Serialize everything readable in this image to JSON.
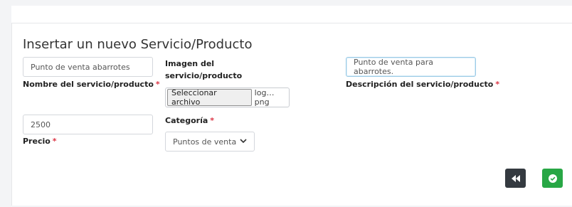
{
  "form": {
    "title": "Insertar un nuevo Servicio/Producto",
    "name_field": {
      "value": "Punto de venta abarrotes",
      "label": "Nombre del servicio/producto",
      "required_mark": "*"
    },
    "image_field": {
      "label": "Imagen del servicio/producto",
      "button_label": "Seleccionar archivo",
      "file_name": "log…png"
    },
    "description_field": {
      "value": "Punto de venta para abarrotes.",
      "label": "Descripción del servicio/producto",
      "required_mark": "*"
    },
    "price_field": {
      "value": "2500",
      "label": "Precio",
      "required_mark": "*"
    },
    "category_field": {
      "label": "Categoría",
      "required_mark": "*",
      "selected": "Puntos de venta"
    }
  },
  "actions": {
    "back_icon": "rewind-icon",
    "submit_icon": "check-circle-icon",
    "back_color": "#343a40",
    "submit_color": "#28a745"
  }
}
